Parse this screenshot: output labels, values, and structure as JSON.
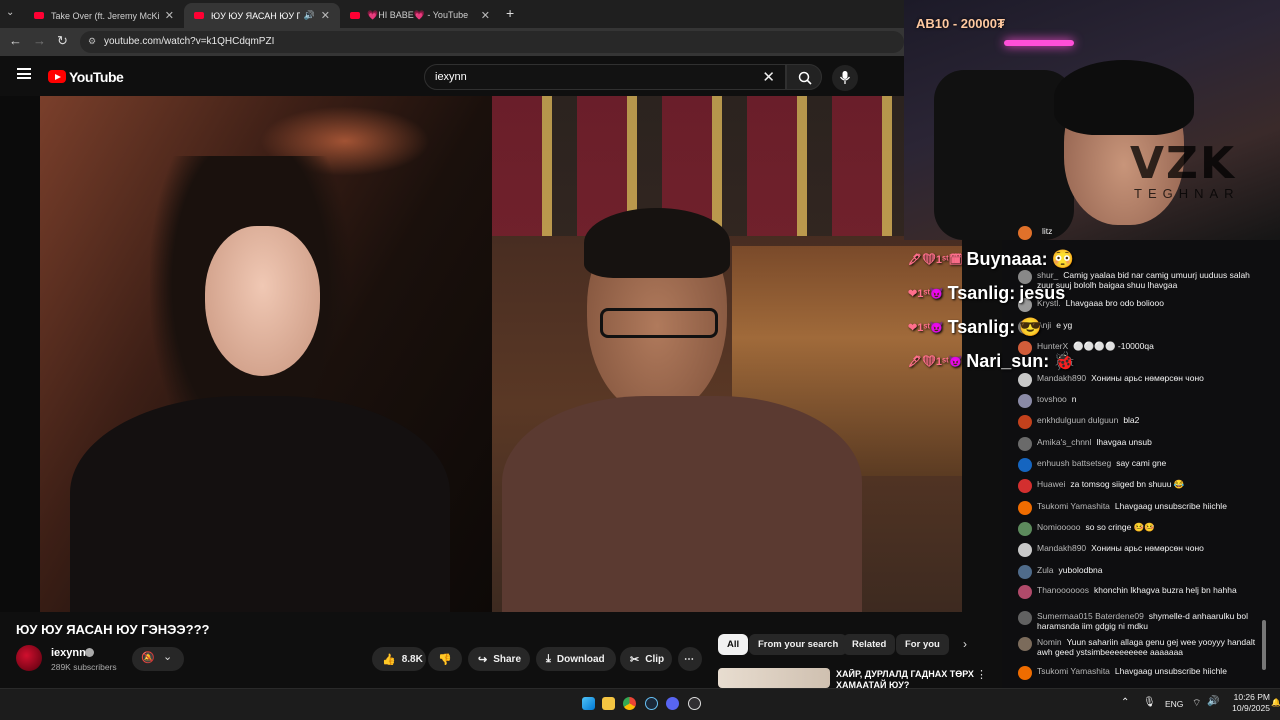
{
  "browser": {
    "tabs": [
      {
        "label": "Take Over (ft. Jeremy McKinnon",
        "active": false
      },
      {
        "label": "ЮУ ЮУ ЯАСАН ЮУ ГЭНЭЭ",
        "active": true
      },
      {
        "label": "💗HI BABE💗 - YouTube",
        "active": false
      }
    ],
    "url": "youtube.com/watch?v=k1QHCdqmPZI"
  },
  "youtube": {
    "logo": "YouTube",
    "search_value": "iexynn",
    "video": {
      "title": "ЮУ ЮУ ЯАСАН ЮУ ГЭНЭЭ???",
      "progress": 0.99
    },
    "channel": {
      "name": "iexynn",
      "subscribers": "289K subscribers"
    },
    "actions": {
      "likes": "8.8K",
      "share": "Share",
      "download": "Download",
      "clip": "Clip"
    },
    "chips": [
      "All",
      "From your search",
      "Related",
      "For you"
    ],
    "recommendation": {
      "title": "ХАЙР, ДУРЛАЛД ГАДНАХ ТӨРХ ХАМААТАЙ ЮУ?"
    }
  },
  "stream": {
    "donation": "АВ10 - 20000₮",
    "brand_logo": "VZK",
    "brand_sub": "TEGHNAR",
    "big_chat": [
      {
        "name": "Buynaaa:",
        "text": "😳"
      },
      {
        "name": "Tsanlig:",
        "text": "jesus"
      },
      {
        "name": "Tsanlig:",
        "text": "😎"
      },
      {
        "name": "Nari_sun:",
        "text": "🐞"
      }
    ],
    "chat": [
      {
        "user": "",
        "text": "litz",
        "color": "#e0712a"
      },
      {
        "user": "shur_",
        "text": "Camig yaalaa bid nar camig umuurj uuduus salah zuur suuj bololh baigaa shuu lhavgaa",
        "color": "#888"
      },
      {
        "user": "Krystl.",
        "text": "Lhavgaaa bro odo boliooo",
        "color": "#999"
      },
      {
        "user": "Anji",
        "text": "e yg",
        "color": "#777"
      },
      {
        "user": "HunterX",
        "text": "⚪⚪⚪⚪ -10000qa",
        "color": "#d15d3a"
      },
      {
        "user": "Mandakh890",
        "text": "Хонины арьс нөмөрсөн чоно",
        "color": "#c8c8c8"
      },
      {
        "user": "tovshoo",
        "text": "n",
        "color": "#8a8aa6"
      },
      {
        "user": "enkhdulguun dulguun",
        "text": "bla2",
        "color": "#c2411c"
      },
      {
        "user": "Amika's_chnnl",
        "text": "lhavgaa unsub",
        "color": "#6a6a6a"
      },
      {
        "user": "enhuush battsetseg",
        "text": "say cami gne",
        "color": "#1565c0"
      },
      {
        "user": "Huawei",
        "text": "za tomsog siiged bn shuuu 😂",
        "color": "#d32f2f"
      },
      {
        "user": "Tsukomi Yamashita",
        "text": "Lhavgaag unsubscribe hiichle",
        "color": "#ef6c00"
      },
      {
        "user": "Nomiooooo",
        "text": "so so cringe 🤒🤒",
        "color": "#5c8a5c"
      },
      {
        "user": "Mandakh890",
        "text": "Хонины арьс нөмөрсөн чоно",
        "color": "#c8c8c8"
      },
      {
        "user": "Zula",
        "text": "yubolodbna",
        "color": "#4f6b8a"
      },
      {
        "user": "Thanoooooos",
        "text": "khonchin lkhagva buzra helj bn hahha",
        "color": "#b04a6a"
      },
      {
        "user": "Sumermaa015 Baterdene09",
        "text": "shymelle-d anhaarulku bol haramsnda iim gdgig ni mdku",
        "color": "#616161"
      },
      {
        "user": "Nomin",
        "text": "Yuun sahariin allaga genu gej wee yooyyy handalt awh geed ystsimbeeeeeeeee aaaaaaa",
        "color": "#7b6b5b"
      },
      {
        "user": "Tsukomi Yamashita",
        "text": "Lhavgaag unsubscribe hiichle",
        "color": "#ef6c00"
      }
    ]
  },
  "taskbar": {
    "lang": "ENG",
    "time": "10:26 PM",
    "date": "10/9/2025"
  }
}
